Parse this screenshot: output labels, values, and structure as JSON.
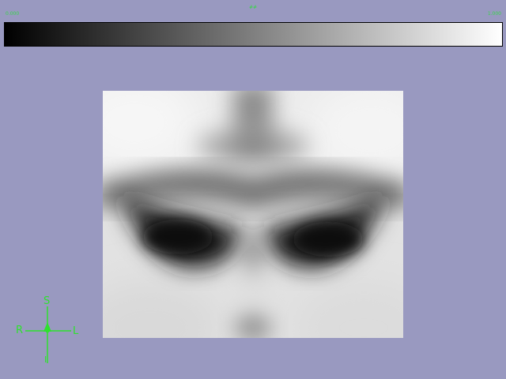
{
  "colorbar": {
    "min_label": "0.000",
    "mid_label": "##",
    "max_label": "1.000",
    "gradient_start": "#000000",
    "gradient_end": "#ffffff"
  },
  "image": {
    "description_icon": "grayscale-slice-image"
  },
  "orientation": {
    "superior": "S",
    "right": "R",
    "left": "L",
    "inferior": "I",
    "color": "#2ee12e"
  },
  "background_color": "#9999c0"
}
